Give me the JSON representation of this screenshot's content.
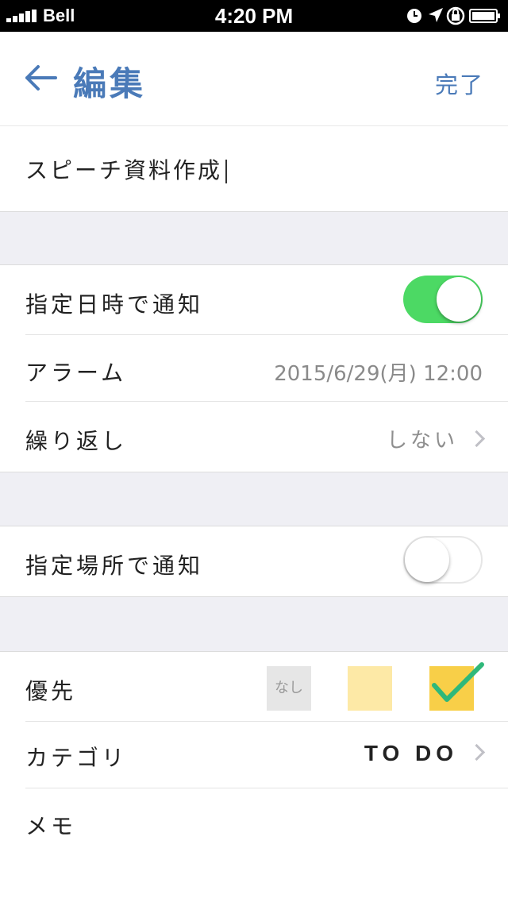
{
  "status_bar": {
    "carrier": "Bell",
    "time": "4:20 PM",
    "icons": [
      "signal-bars-icon",
      "clock-icon",
      "location-arrow-icon",
      "rotation-lock-icon",
      "battery-icon"
    ]
  },
  "nav": {
    "back_icon": "arrow-left-icon",
    "title": "編集",
    "done_label": "完了"
  },
  "task": {
    "title_value": "スピーチ資料作成"
  },
  "time_notify": {
    "label": "指定日時で通知",
    "enabled": true
  },
  "alarm": {
    "label": "アラーム",
    "value": "2015/6/29(月) 12:00"
  },
  "repeat": {
    "label": "繰り返し",
    "value": "しない"
  },
  "place_notify": {
    "label": "指定場所で通知",
    "enabled": false
  },
  "priority": {
    "label": "優先",
    "none_label": "なし",
    "selected": "high"
  },
  "category": {
    "label": "カテゴリ",
    "value": "TO DO"
  },
  "memo": {
    "label": "メモ"
  },
  "colors": {
    "accent": "#4a7ab8",
    "toggle_on": "#4cd964",
    "priority_mid": "#fde9a6",
    "priority_high": "#f8cf48",
    "check": "#2fb87a"
  }
}
